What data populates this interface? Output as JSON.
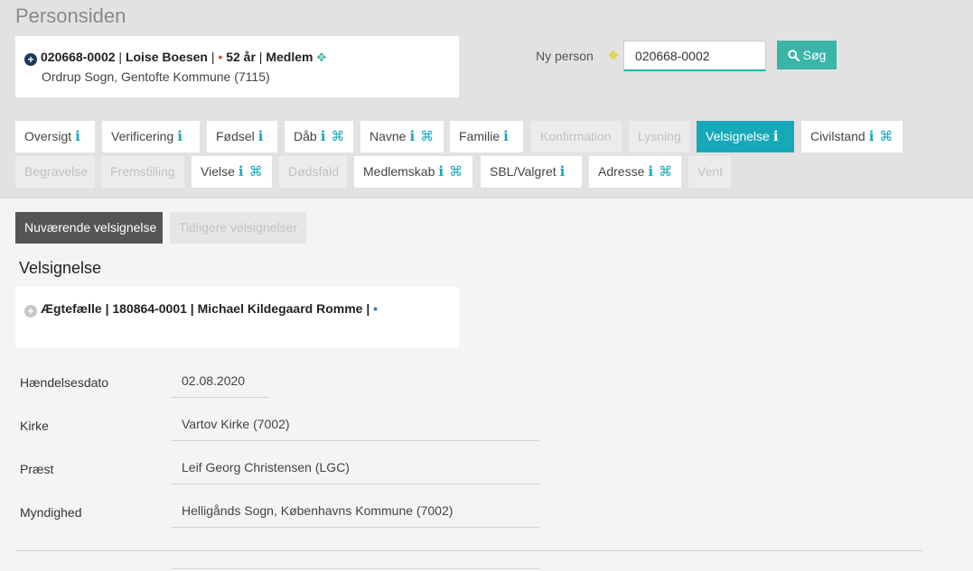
{
  "page": {
    "title": "Personsiden"
  },
  "person": {
    "cpr": "020668-0002",
    "name": "Loise Boesen",
    "age": "52 år",
    "status": "Medlem",
    "parish": "Ordrup Sogn, Gentofte Kommune (7115)"
  },
  "new_person": {
    "label": "Ny person",
    "value": "020668-0002",
    "search_label": "Søg"
  },
  "tabs_row1": [
    {
      "label": "Oversigt",
      "state": "normal",
      "info": true,
      "cmd": false
    },
    {
      "label": "Verificering",
      "state": "normal",
      "info": true,
      "cmd": false
    },
    {
      "label": "Fødsel",
      "state": "normal",
      "info": true,
      "cmd": false
    },
    {
      "label": "Dåb",
      "state": "normal",
      "info": true,
      "cmd": true
    },
    {
      "label": "Navne",
      "state": "normal",
      "info": true,
      "cmd": true
    },
    {
      "label": "Familie",
      "state": "normal",
      "info": true,
      "cmd": false
    },
    {
      "label": "Konfirmation",
      "state": "disabled",
      "info": false,
      "cmd": false
    },
    {
      "label": "Lysning",
      "state": "disabled",
      "info": false,
      "cmd": false
    },
    {
      "label": "Velsignelse",
      "state": "active",
      "info": true,
      "cmd": false
    },
    {
      "label": "Civilstand",
      "state": "normal",
      "info": true,
      "cmd": true
    }
  ],
  "tabs_row2": [
    {
      "label": "Begravelse",
      "state": "disabled",
      "info": false,
      "cmd": false
    },
    {
      "label": "Fremstilling",
      "state": "disabled",
      "info": false,
      "cmd": false
    },
    {
      "label": "Vielse",
      "state": "normal",
      "info": true,
      "cmd": true
    },
    {
      "label": "Dødsfald",
      "state": "disabled",
      "info": false,
      "cmd": false
    },
    {
      "label": "Medlemskab",
      "state": "normal",
      "info": true,
      "cmd": true
    },
    {
      "label": "SBL/Valgret",
      "state": "normal",
      "info": true,
      "cmd": false
    },
    {
      "label": "Adresse",
      "state": "normal",
      "info": true,
      "cmd": true
    },
    {
      "label": "Vent",
      "state": "disabled",
      "info": false,
      "cmd": false
    }
  ],
  "subtabs": {
    "current": "Nuværende velsignelse",
    "previous": "Tidligere velsignelser"
  },
  "section": {
    "title": "Velsignelse",
    "spouse": {
      "role": "Ægtefælle",
      "cpr": "180864-0001",
      "name": "Michael Kildegaard Romme"
    }
  },
  "fields": [
    {
      "label": "Hændelsesdato",
      "value": "02.08.2020"
    },
    {
      "label": "Kirke",
      "value": "Vartov Kirke (7002)"
    },
    {
      "label": "Præst",
      "value": "Leif Georg Christensen (LGC)"
    },
    {
      "label": "Myndighed",
      "value": "Helligånds Sogn, Københavns Kommune (7002)"
    }
  ],
  "colors": {
    "accent": "#17a9b9",
    "search_button": "#3bb5a8",
    "header_bg": "#e2e2e2",
    "current_subtab_bg": "#555555"
  },
  "icons": {
    "info": "i",
    "command": "⌘",
    "plus": "+",
    "search": "magnifier"
  }
}
